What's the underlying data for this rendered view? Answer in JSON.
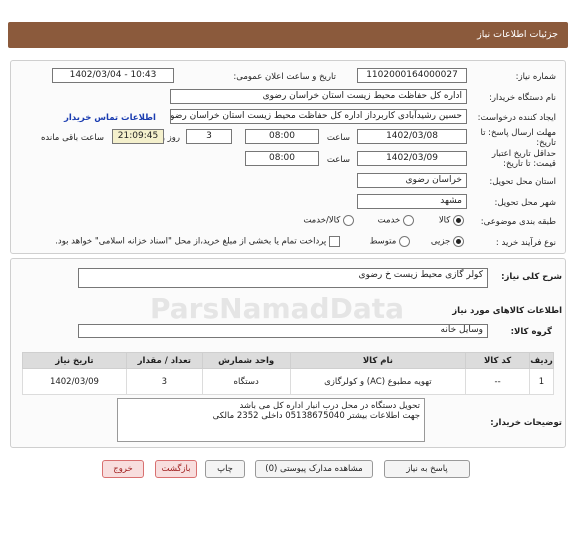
{
  "header": {
    "title": "جزئیات اطلاعات نیاز"
  },
  "form": {
    "need_number_label": "شماره نیاز:",
    "need_number": "1102000164000027",
    "announce_label": "تاریخ و ساعت اعلان عمومی:",
    "announce_value": "1402/03/04 - 10:43",
    "buyer_org_label": "نام دستگاه خریدار:",
    "buyer_org": "اداره کل حفاظت محیط زیست استان خراسان رضوی",
    "creator_label": "ایجاد کننده درخواست:",
    "creator": "حسین رشیدآبادی کاربرداز اداره کل حفاظت محیط زیست استان خراسان رضوی",
    "contact_link": "اطلاعات تماس خریدار",
    "deadline_label": "مهلت ارسال پاسخ: تا تاریخ:",
    "deadline_date": "1402/03/08",
    "time_label": "ساعت",
    "deadline_time": "08:00",
    "days_value": "3",
    "days_label": "روز و",
    "remaining_time": "21:09:45",
    "remaining_label": "ساعت باقی مانده",
    "validity_label": "حداقل تاریخ اعتبار قیمت: تا تاریخ:",
    "validity_date": "1402/03/09",
    "validity_time": "08:00",
    "province_label": "استان محل تحویل:",
    "province": "خراسان رضوی",
    "city_label": "شهر محل تحویل:",
    "city": "مشهد",
    "category_label": "طبقه بندی موضوعی:",
    "category_options": [
      "کالا",
      "خدمت",
      "کالا/خدمت"
    ],
    "process_label": "نوع فرآیند خرید :",
    "process_options": [
      "جزیی",
      "متوسط"
    ],
    "payment_note": "پرداخت تمام یا بخشی از مبلغ خرید،از محل \"اسناد خزانه اسلامی\" خواهد بود."
  },
  "details": {
    "summary_label": "شرح کلی نیاز:",
    "summary": "کولر گازی محیط زیست خ رضوی",
    "goods_info_title": "اطلاعات کالاهای مورد نیاز",
    "goods_group_label": "گروه کالا:",
    "goods_group": "وسایل خانه",
    "watermark": "ParsNamadData"
  },
  "table": {
    "headers": [
      "ردیف",
      "کد کالا",
      "نام کالا",
      "واحد شمارش",
      "تعداد / مقدار",
      "تاریخ نیاز"
    ],
    "rows": [
      [
        "1",
        "--",
        "تهویه مطبوع (AC) و کولرگازی",
        "دستگاه",
        "3",
        "1402/03/09"
      ]
    ]
  },
  "buyer_notes": {
    "label": "توضیحات خریدار:",
    "line1": "تحویل دستگاه در محل درب انبار اداره کل می باشد",
    "line2": "جهت اطلاعات بیشتر 05138675040 داخلی 2352 مالکی"
  },
  "buttons": {
    "reply": "پاسخ به نیاز",
    "attachments": "مشاهده مدارک پیوستی (0)",
    "print": "چاپ",
    "back": "بازگشت",
    "exit": "خروج"
  }
}
